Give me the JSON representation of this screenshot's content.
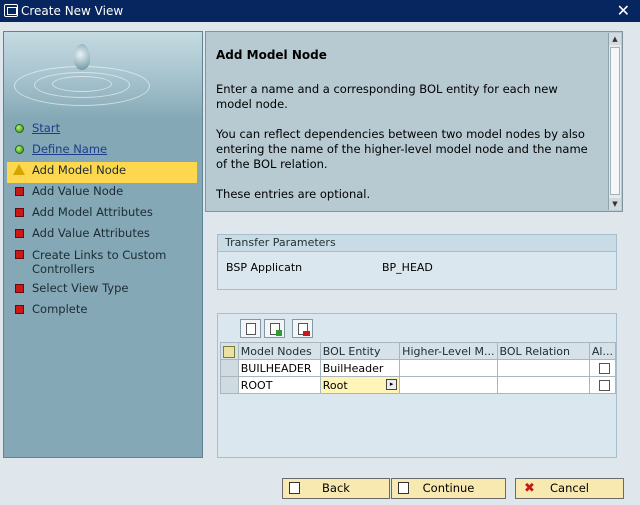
{
  "window": {
    "title": "Create New View"
  },
  "steps": [
    {
      "label": "Start",
      "status": "done"
    },
    {
      "label": "Define Name",
      "status": "done"
    },
    {
      "label": "Add Model Node",
      "status": "current"
    },
    {
      "label": "Add Value Node",
      "status": "pending"
    },
    {
      "label": "Add Model Attributes",
      "status": "pending"
    },
    {
      "label": "Add Value Attributes",
      "status": "pending"
    },
    {
      "label": "Create Links to Custom Controllers",
      "status": "pending"
    },
    {
      "label": "Select View Type",
      "status": "pending"
    },
    {
      "label": "Complete",
      "status": "pending"
    }
  ],
  "info": {
    "title": "Add Model Node",
    "p1": "Enter a name and a corresponding BOL entity for each new model node.",
    "p2": "You can reflect dependencies between two model nodes by also entering the name of the higher-level model node and the name of the BOL relation.",
    "p3": "These entries are optional."
  },
  "transfer": {
    "title": "Transfer Parameters",
    "key": "BSP Applicatn",
    "value": "BP_HEAD"
  },
  "table": {
    "columns": [
      "Model Nodes",
      "BOL Entity",
      "Higher-Level M...",
      "BOL Relation",
      "Al..."
    ],
    "rows": [
      [
        "BUILHEADER",
        "BuilHeader",
        "",
        "",
        ""
      ],
      [
        "ROOT",
        "Root",
        "",
        "",
        ""
      ]
    ]
  },
  "buttons": {
    "back": "Back",
    "continue": "Continue",
    "cancel": "Cancel"
  },
  "colors": {
    "title_bar": "#07255e",
    "active_step": "#fdd84e",
    "button": "#f8e9b0"
  }
}
